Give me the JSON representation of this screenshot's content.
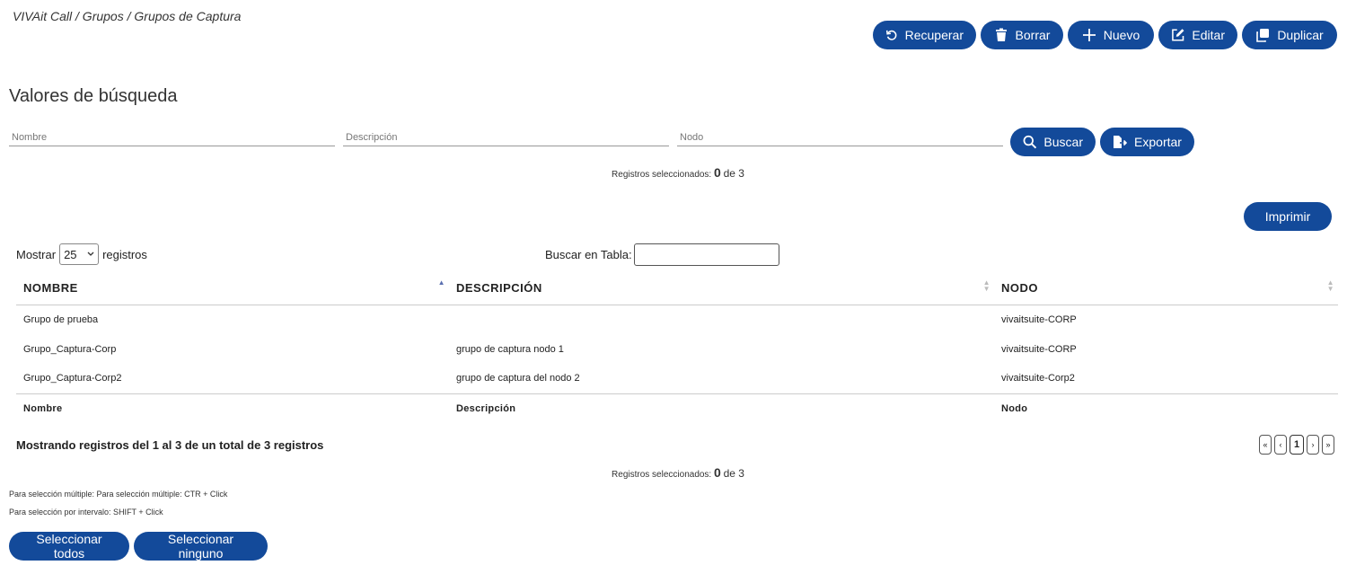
{
  "breadcrumb": "VIVAit Call / Grupos / Grupos de Captura",
  "toolbar": {
    "recover": "Recuperar",
    "delete": "Borrar",
    "new": "Nuevo",
    "edit": "Editar",
    "duplicate": "Duplicar"
  },
  "search": {
    "title": "Valores de búsqueda",
    "name_placeholder": "Nombre",
    "description_placeholder": "Descripción",
    "node_placeholder": "Nodo",
    "search_button": "Buscar",
    "export_button": "Exportar"
  },
  "selected": {
    "label": "Registros seleccionados:",
    "count": "0",
    "of": "de 3"
  },
  "print_button": "Imprimir",
  "table_controls": {
    "show_label": "Mostrar",
    "page_length": "25",
    "records_label": "registros",
    "table_search_label": "Buscar en Tabla:"
  },
  "table": {
    "headers": [
      "NOMBRE",
      "DESCRIPCIÓN",
      "NODO"
    ],
    "rows": [
      {
        "name": "Grupo de prueba",
        "description": "",
        "node": "vivaitsuite-CORP"
      },
      {
        "name": "Grupo_Captura-Corp",
        "description": "grupo de captura nodo 1",
        "node": "vivaitsuite-CORP"
      },
      {
        "name": "Grupo_Captura-Corp2",
        "description": "grupo de captura del nodo 2",
        "node": "vivaitsuite-Corp2"
      }
    ],
    "footers": [
      "Nombre",
      "Descripción",
      "Nodo"
    ]
  },
  "info": "Mostrando registros del 1 al 3 de un total de 3 registros",
  "pager": {
    "first": "«",
    "prev": "‹",
    "current": "1",
    "next": "›",
    "last": "»"
  },
  "hints": {
    "multiple": "Para selección múltiple: Para selección múltiple: CTR + Click",
    "interval": "Para selección por intervalo: SHIFT + Click"
  },
  "select_all": "Seleccionar todos",
  "select_none": "Seleccionar ninguno",
  "colors": {
    "primary": "#134a9a"
  }
}
